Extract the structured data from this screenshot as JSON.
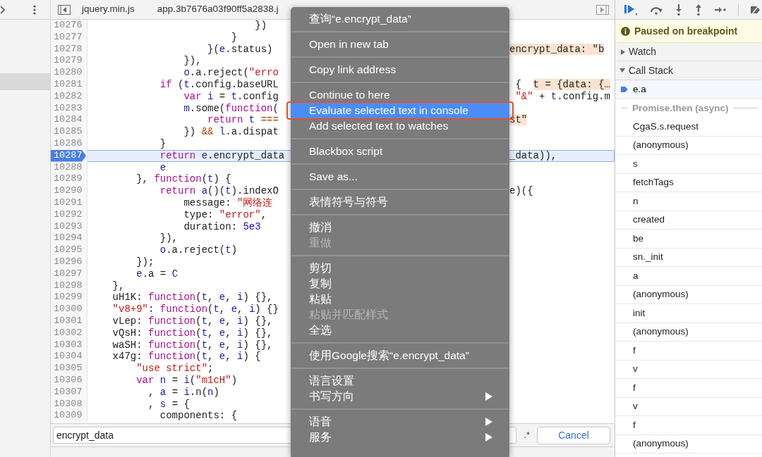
{
  "editor": {
    "tabs": [
      {
        "label": "jquery.min.js",
        "selected": false
      },
      {
        "label": "app.3b7676a03f90ff5a2838.j",
        "selected": false
      }
    ],
    "lines": [
      {
        "number": "10276",
        "current": false,
        "code": [
          {
            "kind": "plain",
            "text": "                            })"
          }
        ]
      },
      {
        "number": "10277",
        "current": false,
        "code": [
          {
            "kind": "plain",
            "text": "                        }"
          }
        ]
      },
      {
        "number": "10278",
        "current": false,
        "code": [
          {
            "kind": "plain",
            "text": "                    }("
          },
          {
            "kind": "variable",
            "text": "e"
          },
          {
            "kind": "plain",
            "text": ".status)"
          }
        ],
        "overlay": [
          {
            "kind": "value",
            "text": "encrypt_data: \"b"
          }
        ]
      },
      {
        "number": "10279",
        "current": false,
        "code": [
          {
            "kind": "plain",
            "text": "                }),"
          }
        ]
      },
      {
        "number": "10280",
        "current": false,
        "code": [
          {
            "kind": "variable",
            "text": "                o"
          },
          {
            "kind": "plain",
            "text": ".a.reject("
          },
          {
            "kind": "string",
            "text": "\"erro"
          }
        ]
      },
      {
        "number": "10281",
        "current": false,
        "code": [
          {
            "kind": "keyword",
            "text": "            if"
          },
          {
            "kind": "plain",
            "text": " ("
          },
          {
            "kind": "variable",
            "text": "t"
          },
          {
            "kind": "plain",
            "text": ".config.baseURL"
          }
        ],
        "overlay": [
          {
            "kind": "plain",
            "text": " {  "
          },
          {
            "kind": "value",
            "text": "t = {data: {…"
          }
        ]
      },
      {
        "number": "10282",
        "current": false,
        "code": [
          {
            "kind": "keyword",
            "text": "                var"
          },
          {
            "kind": "variable",
            "text": " i"
          },
          {
            "kind": "plain",
            "text": " = "
          },
          {
            "kind": "variable",
            "text": "t"
          },
          {
            "kind": "plain",
            "text": ".config"
          }
        ],
        "overlay": [
          {
            "kind": "string",
            "text": " \"&\""
          },
          {
            "kind": "plain",
            "text": " + "
          },
          {
            "kind": "variable",
            "text": "t"
          },
          {
            "kind": "plain",
            "text": ".config.m"
          }
        ]
      },
      {
        "number": "10283",
        "current": false,
        "code": [
          {
            "kind": "variable",
            "text": "                m"
          },
          {
            "kind": "plain",
            "text": ".some("
          },
          {
            "kind": "keyword",
            "text": "function"
          },
          {
            "kind": "plain",
            "text": "("
          }
        ]
      },
      {
        "number": "10284",
        "current": false,
        "code": [
          {
            "kind": "keyword",
            "text": "                    return"
          },
          {
            "kind": "variable",
            "text": " t"
          },
          {
            "kind": "operator",
            "text": " ==="
          }
        ],
        "overlay": [
          {
            "kind": "value",
            "text": "st\""
          }
        ]
      },
      {
        "number": "10285",
        "current": false,
        "code": [
          {
            "kind": "plain",
            "text": "                }) "
          },
          {
            "kind": "operator",
            "text": "&&"
          },
          {
            "kind": "variable",
            "text": " l"
          },
          {
            "kind": "plain",
            "text": ".a.dispat"
          }
        ]
      },
      {
        "number": "10286",
        "current": false,
        "code": [
          {
            "kind": "plain",
            "text": "            }"
          }
        ]
      },
      {
        "number": "10287",
        "current": true,
        "code": [
          {
            "kind": "keyword",
            "text": "            return"
          },
          {
            "kind": "variable",
            "text": " e"
          },
          {
            "kind": "plain",
            "text": ".encrypt_data"
          }
        ],
        "overlay": [
          {
            "kind": "plain",
            "text": "_data)),"
          }
        ]
      },
      {
        "number": "10288",
        "current": false,
        "code": [
          {
            "kind": "variable",
            "text": "            e"
          }
        ]
      },
      {
        "number": "10289",
        "current": false,
        "code": [
          {
            "kind": "plain",
            "text": "        }, "
          },
          {
            "kind": "keyword",
            "text": "function"
          },
          {
            "kind": "plain",
            "text": "("
          },
          {
            "kind": "variable",
            "text": "t"
          },
          {
            "kind": "plain",
            "text": ") {"
          }
        ]
      },
      {
        "number": "10290",
        "current": false,
        "code": [
          {
            "kind": "keyword",
            "text": "            return"
          },
          {
            "kind": "variable",
            "text": " a"
          },
          {
            "kind": "plain",
            "text": "()("
          },
          {
            "kind": "variable",
            "text": "t"
          },
          {
            "kind": "plain",
            "text": ").indexO"
          }
        ],
        "overlay": [
          {
            "kind": "plain",
            "text": "e)({"
          }
        ]
      },
      {
        "number": "10291",
        "current": false,
        "code": [
          {
            "kind": "plain",
            "text": "                message: "
          },
          {
            "kind": "string",
            "text": "\"网络连"
          }
        ]
      },
      {
        "number": "10292",
        "current": false,
        "code": [
          {
            "kind": "plain",
            "text": "                type: "
          },
          {
            "kind": "string",
            "text": "\"error\""
          },
          {
            "kind": "plain",
            "text": ","
          }
        ]
      },
      {
        "number": "10293",
        "current": false,
        "code": [
          {
            "kind": "plain",
            "text": "                duration: "
          },
          {
            "kind": "number",
            "text": "5e3"
          }
        ]
      },
      {
        "number": "10294",
        "current": false,
        "code": [
          {
            "kind": "plain",
            "text": "            }),"
          }
        ]
      },
      {
        "number": "10295",
        "current": false,
        "code": [
          {
            "kind": "variable",
            "text": "            o"
          },
          {
            "kind": "plain",
            "text": ".a.reject("
          },
          {
            "kind": "variable",
            "text": "t"
          },
          {
            "kind": "plain",
            "text": ")"
          }
        ]
      },
      {
        "number": "10296",
        "current": false,
        "code": [
          {
            "kind": "plain",
            "text": "        });"
          }
        ]
      },
      {
        "number": "10297",
        "current": false,
        "code": [
          {
            "kind": "variable",
            "text": "        e"
          },
          {
            "kind": "plain",
            "text": ".a = "
          },
          {
            "kind": "variable",
            "text": "C"
          }
        ]
      },
      {
        "number": "10298",
        "current": false,
        "code": [
          {
            "kind": "plain",
            "text": "    },"
          }
        ]
      },
      {
        "number": "10299",
        "current": false,
        "code": [
          {
            "kind": "plain",
            "text": "    uH1K: "
          },
          {
            "kind": "keyword",
            "text": "function"
          },
          {
            "kind": "plain",
            "text": "("
          },
          {
            "kind": "variable",
            "text": "t"
          },
          {
            "kind": "plain",
            "text": ", "
          },
          {
            "kind": "variable",
            "text": "e"
          },
          {
            "kind": "plain",
            "text": ", "
          },
          {
            "kind": "variable",
            "text": "i"
          },
          {
            "kind": "plain",
            "text": ") {},"
          }
        ]
      },
      {
        "number": "10300",
        "current": false,
        "code": [
          {
            "kind": "string",
            "text": "    \"v8+9\""
          },
          {
            "kind": "plain",
            "text": ": "
          },
          {
            "kind": "keyword",
            "text": "function"
          },
          {
            "kind": "plain",
            "text": "("
          },
          {
            "kind": "variable",
            "text": "t"
          },
          {
            "kind": "plain",
            "text": ", "
          },
          {
            "kind": "variable",
            "text": "e"
          },
          {
            "kind": "plain",
            "text": ", "
          },
          {
            "kind": "variable",
            "text": "i"
          },
          {
            "kind": "plain",
            "text": ") {}"
          }
        ]
      },
      {
        "number": "10301",
        "current": false,
        "code": [
          {
            "kind": "plain",
            "text": "    vLep: "
          },
          {
            "kind": "keyword",
            "text": "function"
          },
          {
            "kind": "plain",
            "text": "("
          },
          {
            "kind": "variable",
            "text": "t"
          },
          {
            "kind": "plain",
            "text": ", "
          },
          {
            "kind": "variable",
            "text": "e"
          },
          {
            "kind": "plain",
            "text": ", "
          },
          {
            "kind": "variable",
            "text": "i"
          },
          {
            "kind": "plain",
            "text": ") {},"
          }
        ]
      },
      {
        "number": "10302",
        "current": false,
        "code": [
          {
            "kind": "plain",
            "text": "    vQsH: "
          },
          {
            "kind": "keyword",
            "text": "function"
          },
          {
            "kind": "plain",
            "text": "("
          },
          {
            "kind": "variable",
            "text": "t"
          },
          {
            "kind": "plain",
            "text": ", "
          },
          {
            "kind": "variable",
            "text": "e"
          },
          {
            "kind": "plain",
            "text": ", "
          },
          {
            "kind": "variable",
            "text": "i"
          },
          {
            "kind": "plain",
            "text": ") {},"
          }
        ]
      },
      {
        "number": "10303",
        "current": false,
        "code": [
          {
            "kind": "plain",
            "text": "    waSH: "
          },
          {
            "kind": "keyword",
            "text": "function"
          },
          {
            "kind": "plain",
            "text": "("
          },
          {
            "kind": "variable",
            "text": "t"
          },
          {
            "kind": "plain",
            "text": ", "
          },
          {
            "kind": "variable",
            "text": "e"
          },
          {
            "kind": "plain",
            "text": ", "
          },
          {
            "kind": "variable",
            "text": "i"
          },
          {
            "kind": "plain",
            "text": ") {},"
          }
        ]
      },
      {
        "number": "10304",
        "current": false,
        "code": [
          {
            "kind": "plain",
            "text": "    x47g: "
          },
          {
            "kind": "keyword",
            "text": "function"
          },
          {
            "kind": "plain",
            "text": "("
          },
          {
            "kind": "variable",
            "text": "t"
          },
          {
            "kind": "plain",
            "text": ", "
          },
          {
            "kind": "variable",
            "text": "e"
          },
          {
            "kind": "plain",
            "text": ", "
          },
          {
            "kind": "variable",
            "text": "i"
          },
          {
            "kind": "plain",
            "text": ") {"
          }
        ]
      },
      {
        "number": "10305",
        "current": false,
        "code": [
          {
            "kind": "string",
            "text": "        \"use strict\""
          },
          {
            "kind": "plain",
            "text": ";"
          }
        ]
      },
      {
        "number": "10306",
        "current": false,
        "code": [
          {
            "kind": "keyword",
            "text": "        var"
          },
          {
            "kind": "variable",
            "text": " n"
          },
          {
            "kind": "plain",
            "text": " = "
          },
          {
            "kind": "variable",
            "text": "i"
          },
          {
            "kind": "plain",
            "text": "("
          },
          {
            "kind": "string",
            "text": "\"m1cH\""
          },
          {
            "kind": "plain",
            "text": ")"
          }
        ]
      },
      {
        "number": "10307",
        "current": false,
        "code": [
          {
            "kind": "plain",
            "text": "          , "
          },
          {
            "kind": "variable",
            "text": "a"
          },
          {
            "kind": "plain",
            "text": " = "
          },
          {
            "kind": "variable",
            "text": "i"
          },
          {
            "kind": "plain",
            "text": ".n("
          },
          {
            "kind": "variable",
            "text": "n"
          },
          {
            "kind": "plain",
            "text": ")"
          }
        ]
      },
      {
        "number": "10308",
        "current": false,
        "code": [
          {
            "kind": "plain",
            "text": "          , "
          },
          {
            "kind": "variable",
            "text": "s"
          },
          {
            "kind": "plain",
            "text": " = {"
          }
        ]
      },
      {
        "number": "10309",
        "current": false,
        "code": [
          {
            "kind": "plain",
            "text": "            components: {"
          }
        ]
      }
    ],
    "search": {
      "value": "encrypt_data",
      "regex_label": ".*",
      "cancel": "Cancel"
    }
  },
  "debugger": {
    "banner": "Paused on breakpoint",
    "watch": {
      "label": "Watch",
      "expanded": false
    },
    "call_stack": {
      "label": "Call Stack",
      "expanded": true,
      "frames": [
        {
          "kind": "frame",
          "name": "e.a",
          "selected": true
        },
        {
          "kind": "async",
          "name": "Promise.then (async)"
        },
        {
          "kind": "frame",
          "name": "CgaS.s.request",
          "selected": false
        },
        {
          "kind": "frame",
          "name": "(anonymous)",
          "selected": false
        },
        {
          "kind": "frame",
          "name": "s",
          "selected": false
        },
        {
          "kind": "frame",
          "name": "fetchTags",
          "selected": false
        },
        {
          "kind": "frame",
          "name": "n",
          "selected": false
        },
        {
          "kind": "frame",
          "name": "created",
          "selected": false
        },
        {
          "kind": "frame",
          "name": "be",
          "selected": false
        },
        {
          "kind": "frame",
          "name": "sn._init",
          "selected": false
        },
        {
          "kind": "frame",
          "name": "a",
          "selected": false
        },
        {
          "kind": "frame",
          "name": "(anonymous)",
          "selected": false
        },
        {
          "kind": "frame",
          "name": "init",
          "selected": false
        },
        {
          "kind": "frame",
          "name": "(anonymous)",
          "selected": false
        },
        {
          "kind": "frame",
          "name": "f",
          "selected": false
        },
        {
          "kind": "frame",
          "name": "v",
          "selected": false
        },
        {
          "kind": "frame",
          "name": "f",
          "selected": false
        },
        {
          "kind": "frame",
          "name": "v",
          "selected": false
        },
        {
          "kind": "frame",
          "name": "f",
          "selected": false
        },
        {
          "kind": "frame",
          "name": "(anonymous)",
          "selected": false
        }
      ]
    }
  },
  "context_menu": {
    "groups": [
      {
        "items": [
          {
            "label": "查询“e.encrypt_data”",
            "disabled": false,
            "selected": false,
            "submenu": false
          }
        ]
      },
      {
        "items": [
          {
            "label": "Open in new tab",
            "disabled": false,
            "selected": false,
            "submenu": false
          }
        ]
      },
      {
        "items": [
          {
            "label": "Copy link address",
            "disabled": false,
            "selected": false,
            "submenu": false
          }
        ]
      },
      {
        "items": [
          {
            "label": "Continue to here",
            "disabled": false,
            "selected": false,
            "submenu": false
          },
          {
            "label": "Evaluate selected text in console",
            "disabled": false,
            "selected": true,
            "submenu": false
          },
          {
            "label": "Add selected text to watches",
            "disabled": false,
            "selected": false,
            "submenu": false
          }
        ]
      },
      {
        "items": [
          {
            "label": "Blackbox script",
            "disabled": false,
            "selected": false,
            "submenu": false
          }
        ]
      },
      {
        "items": [
          {
            "label": "Save as...",
            "disabled": false,
            "selected": false,
            "submenu": false
          }
        ]
      },
      {
        "items": [
          {
            "label": "表情符号与符号",
            "disabled": false,
            "selected": false,
            "submenu": false
          }
        ]
      },
      {
        "items": [
          {
            "label": "撤消",
            "disabled": false,
            "selected": false,
            "submenu": false
          },
          {
            "label": "重做",
            "disabled": true,
            "selected": false,
            "submenu": false
          }
        ]
      },
      {
        "items": [
          {
            "label": "剪切",
            "disabled": false,
            "selected": false,
            "submenu": false
          },
          {
            "label": "复制",
            "disabled": false,
            "selected": false,
            "submenu": false
          },
          {
            "label": "粘贴",
            "disabled": false,
            "selected": false,
            "submenu": false
          },
          {
            "label": "粘贴并匹配样式",
            "disabled": true,
            "selected": false,
            "submenu": false
          },
          {
            "label": "全选",
            "disabled": false,
            "selected": false,
            "submenu": false
          }
        ]
      },
      {
        "items": [
          {
            "label": "使用Google搜索“e.encrypt_data”",
            "disabled": false,
            "selected": false,
            "submenu": false
          }
        ]
      },
      {
        "items": [
          {
            "label": "语言设置",
            "disabled": false,
            "selected": false,
            "submenu": false
          },
          {
            "label": "书写方向",
            "disabled": false,
            "selected": false,
            "submenu": true
          }
        ]
      },
      {
        "items": [
          {
            "label": "语音",
            "disabled": false,
            "selected": false,
            "submenu": true
          },
          {
            "label": "服务",
            "disabled": false,
            "selected": false,
            "submenu": true
          }
        ]
      }
    ]
  }
}
